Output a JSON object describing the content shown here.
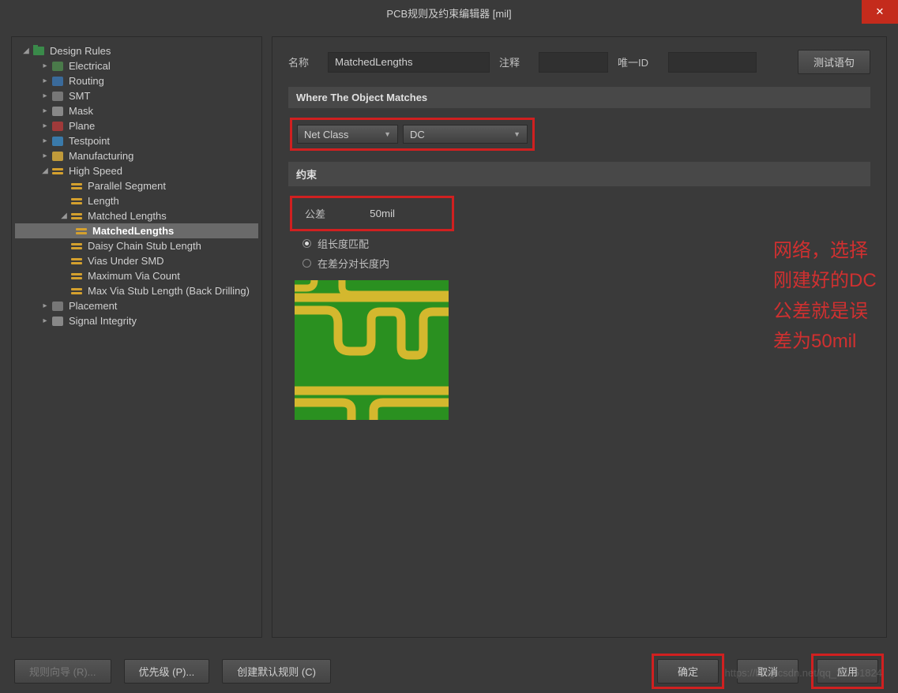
{
  "window": {
    "title": "PCB规则及约束编辑器 [mil]"
  },
  "tree": {
    "root": "Design Rules",
    "electrical": "Electrical",
    "routing": "Routing",
    "smt": "SMT",
    "mask": "Mask",
    "plane": "Plane",
    "testpoint": "Testpoint",
    "manufacturing": "Manufacturing",
    "highspeed": "High Speed",
    "hs_parallel": "Parallel Segment",
    "hs_length": "Length",
    "hs_matched": "Matched Lengths",
    "hs_matched_rule": "MatchedLengths",
    "hs_daisy": "Daisy Chain Stub Length",
    "hs_vias": "Vias Under SMD",
    "hs_maxvia": "Maximum Via Count",
    "hs_maxstub": "Max Via Stub Length (Back Drilling)",
    "placement": "Placement",
    "signal": "Signal Integrity"
  },
  "form": {
    "name_label": "名称",
    "name_value": "MatchedLengths",
    "comment_label": "注释",
    "id_label": "唯一ID",
    "test_button": "测试语句"
  },
  "matches": {
    "header": "Where The Object Matches",
    "scope": "Net Class",
    "value": "DC"
  },
  "constraints": {
    "header": "约束",
    "tolerance_label": "公差",
    "tolerance_value": "50mil",
    "radio_group": "组长度匹配",
    "radio_diff": "在差分对长度内"
  },
  "annotation": {
    "line1": "网络，选择刚建好的DC",
    "line2": "公差就是误差为50mil"
  },
  "footer": {
    "wizard": "规则向导 (R)...",
    "priority": "优先级 (P)...",
    "defaults": "创建默认规则 (C)",
    "ok": "确定",
    "cancel": "取消",
    "apply": "应用"
  },
  "watermark": "https://blog.csdn.net/qq_38351824"
}
